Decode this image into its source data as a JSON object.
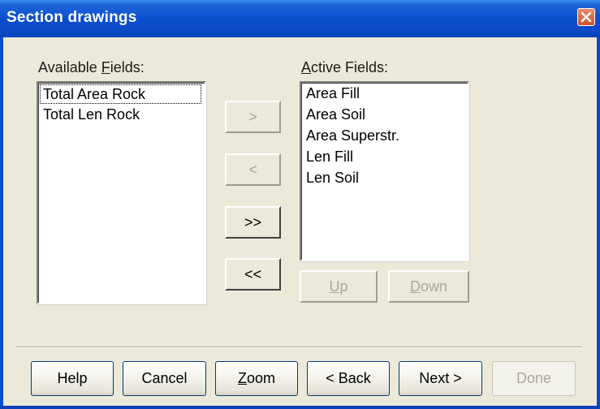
{
  "window": {
    "title": "Section drawings",
    "close_icon": "close-icon"
  },
  "available": {
    "label_prefix": "Available ",
    "label_accel": "F",
    "label_suffix": "ields:",
    "items": [
      "Total Area Rock",
      "Total Len Rock"
    ]
  },
  "active": {
    "label_prefix": "",
    "label_accel": "A",
    "label_suffix": "ctive Fields:",
    "items": [
      "Area Fill",
      "Area Soil",
      "Area Superstr.",
      "Len Fill",
      "Len Soil"
    ]
  },
  "transfer": {
    "add_one": ">",
    "remove_one": "<",
    "add_all": ">>",
    "remove_all": "<<"
  },
  "reorder": {
    "up_accel": "U",
    "up_rest": "p",
    "down_accel": "D",
    "down_rest": "own"
  },
  "footer": {
    "help": "Help",
    "cancel": "Cancel",
    "zoom_accel": "Z",
    "zoom_rest": "oom",
    "back": "< Back",
    "next": "Next >",
    "done": "Done"
  },
  "colors": {
    "title_bar": "#0a4fd0",
    "dialog_bg": "#ece9d8",
    "close_button": "#d2502c",
    "disabled_text": "#aca899"
  }
}
